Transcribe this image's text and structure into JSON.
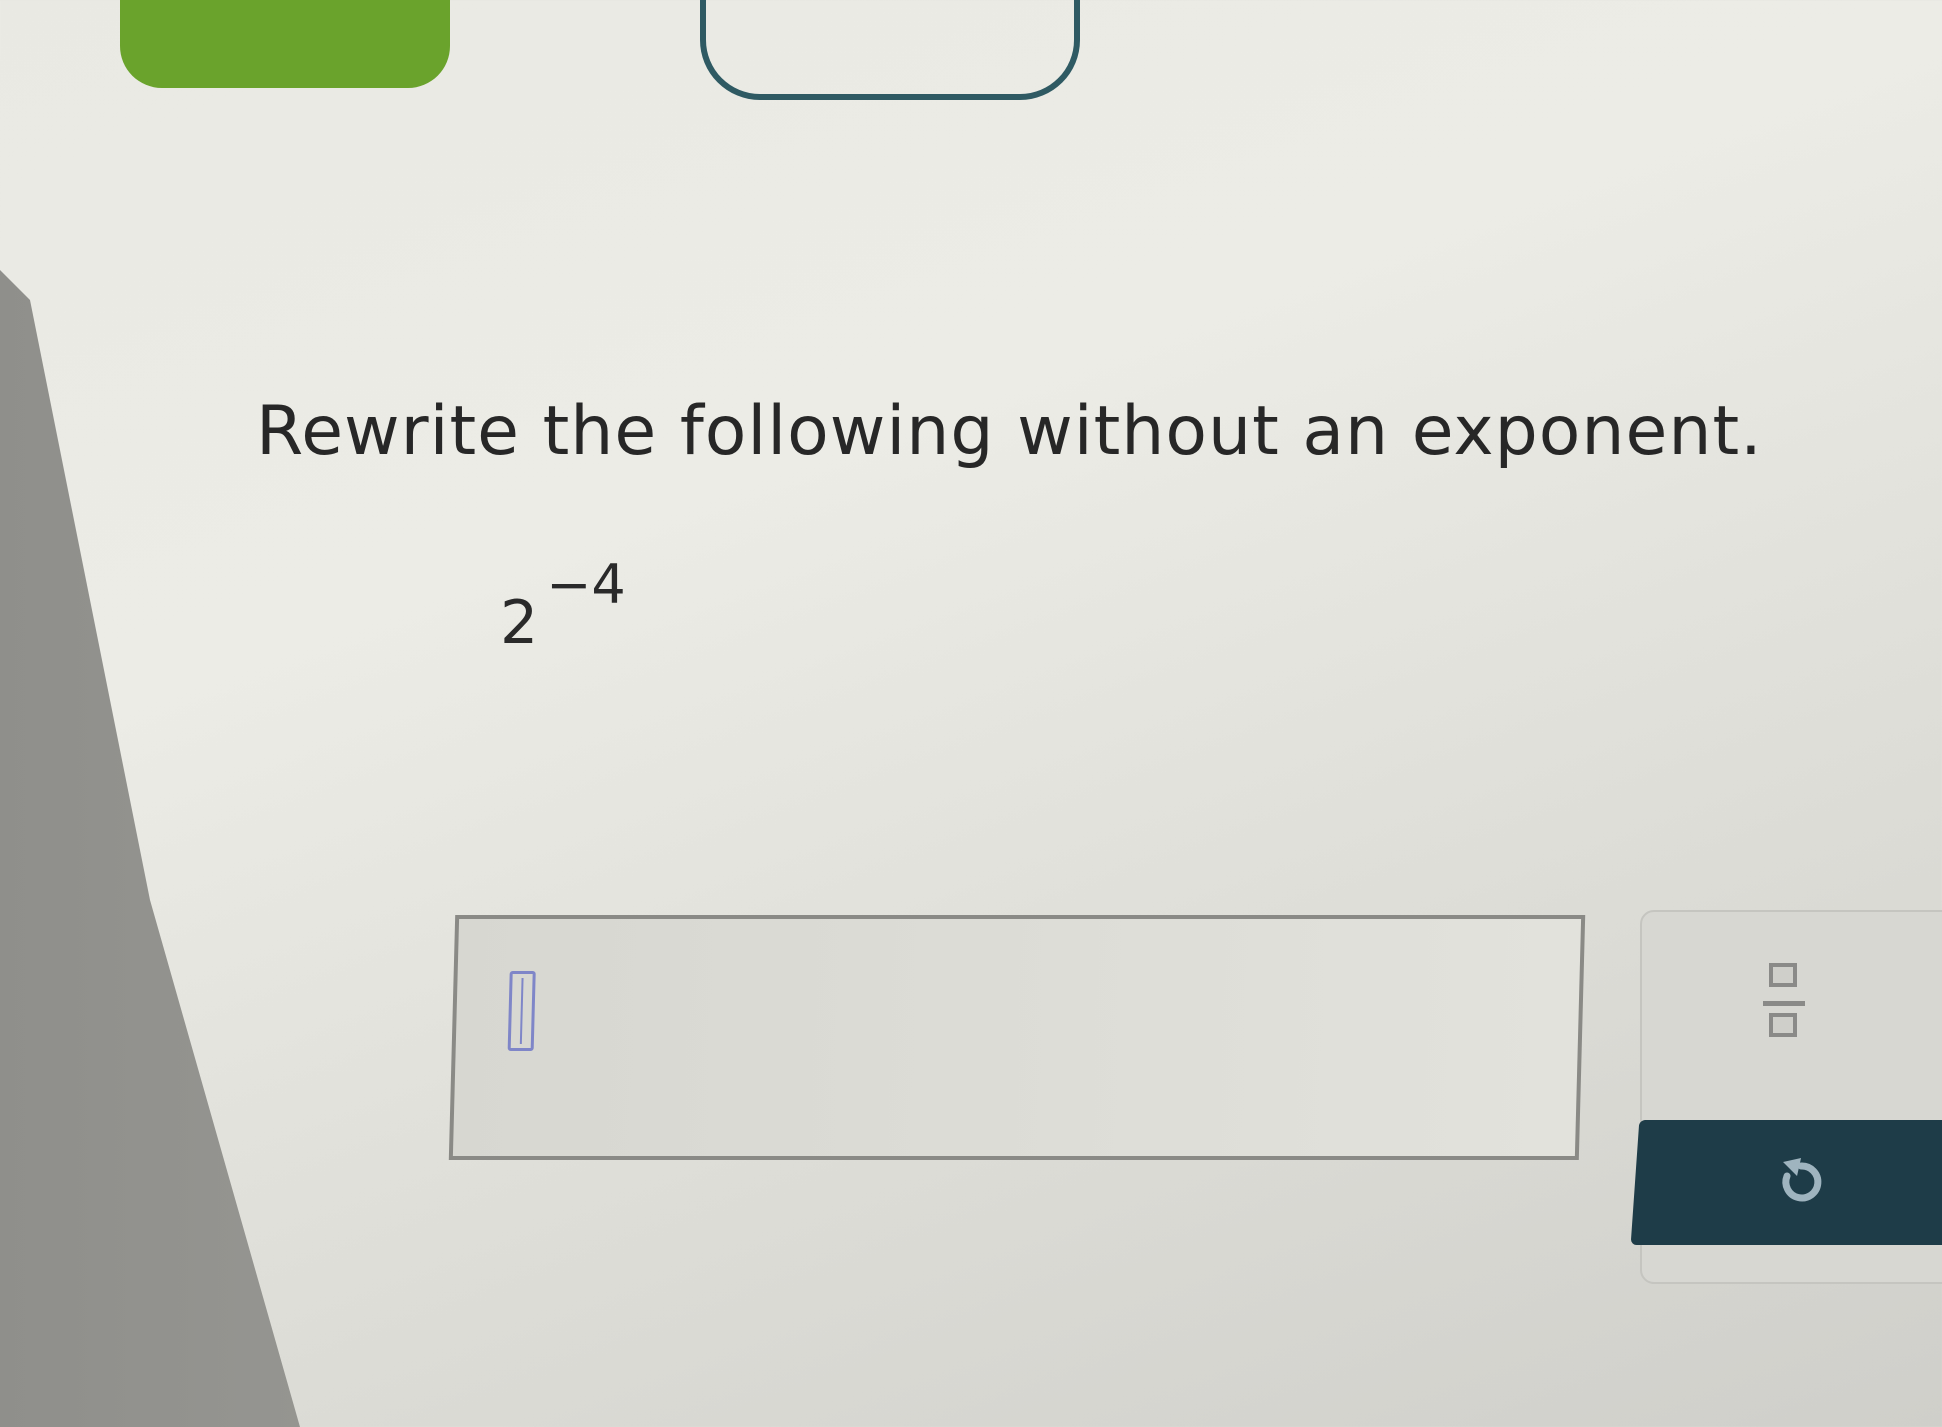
{
  "question": {
    "prompt": "Rewrite the following without an exponent.",
    "expression": {
      "base": "2",
      "exponent": "−4"
    }
  },
  "answer": {
    "value": ""
  },
  "toolbar": {
    "icons": [
      "fraction-icon",
      "undo-icon"
    ]
  },
  "colors": {
    "top_button_green": "#6aa32c",
    "top_button_outline": "#2f5a63",
    "undo_button_bg": "#1e3c48",
    "cursor_slot": "#7f86c8"
  }
}
